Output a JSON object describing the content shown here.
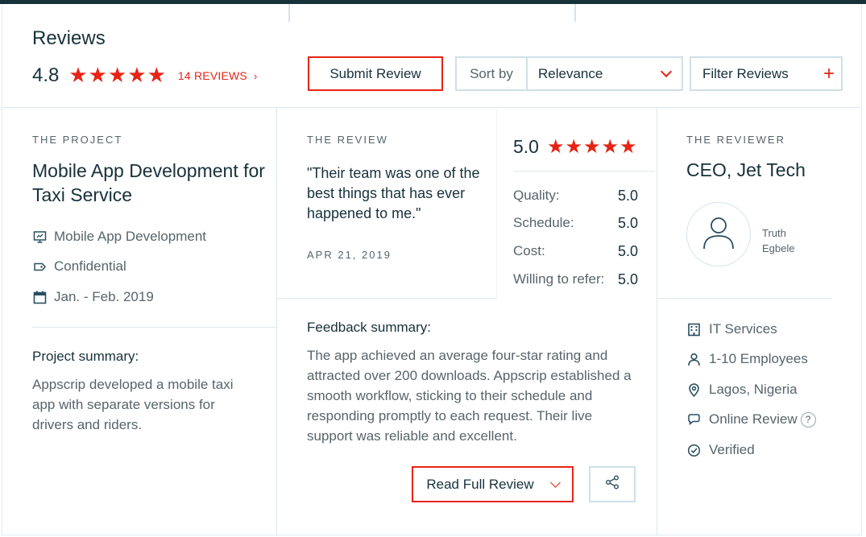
{
  "header": {
    "title": "Reviews",
    "rating": "4.8",
    "stars": "★★★★★",
    "reviews_link": "14 REVIEWS",
    "reviews_chevron": "›",
    "submit_label": "Submit Review",
    "sort_label": "Sort by",
    "sort_value": "Relevance",
    "filter_label": "Filter Reviews",
    "filter_plus": "+"
  },
  "project": {
    "eyebrow": "THE PROJECT",
    "title": "Mobile App Development for Taxi Service",
    "service": "Mobile App Development",
    "budget": "Confidential",
    "dates": "Jan. - Feb. 2019",
    "summary_heading": "Project summary:",
    "summary_text": "Appscrip developed a mobile taxi app with separate versions for drivers and riders."
  },
  "review": {
    "eyebrow": "THE REVIEW",
    "quote": "\"Their team was one of the best things that has ever happened to me.\"",
    "date": "APR 21, 2019",
    "overall": "5.0",
    "stars": "★★★★★",
    "scores": [
      {
        "label": "Quality:",
        "value": "5.0"
      },
      {
        "label": "Schedule:",
        "value": "5.0"
      },
      {
        "label": "Cost:",
        "value": "5.0"
      },
      {
        "label": "Willing to refer:",
        "value": "5.0"
      }
    ],
    "feedback_heading": "Feedback summary:",
    "feedback_text": "The app achieved an average four-star rating and attracted over 200 downloads. Appscrip established a smooth workflow, sticking to their schedule and responding promptly to each request. Their live support was reliable and excellent.",
    "read_full_label": "Read Full Review"
  },
  "reviewer": {
    "eyebrow": "THE REVIEWER",
    "title": "CEO, Jet Tech",
    "name_first": "Truth",
    "name_last": "Egbele",
    "industry": "IT Services",
    "size": "1-10 Employees",
    "location": "Lagos, Nigeria",
    "review_type": "Online Review",
    "help_mark": "?",
    "status": "Verified"
  },
  "colors": {
    "accent": "#e62415",
    "text_dark": "#17313b",
    "text_muted": "#57646a",
    "border": "#cfe0e8",
    "icon": "#2a4e60"
  },
  "icons": [
    "presentation-icon",
    "tag-icon",
    "calendar-icon",
    "share-icon",
    "user-icon",
    "building-icon",
    "person-icon",
    "location-pin-icon",
    "chat-bubble-icon",
    "check-circle-icon",
    "help-icon",
    "chevron-down-icon",
    "plus-icon",
    "chevron-right-icon"
  ]
}
